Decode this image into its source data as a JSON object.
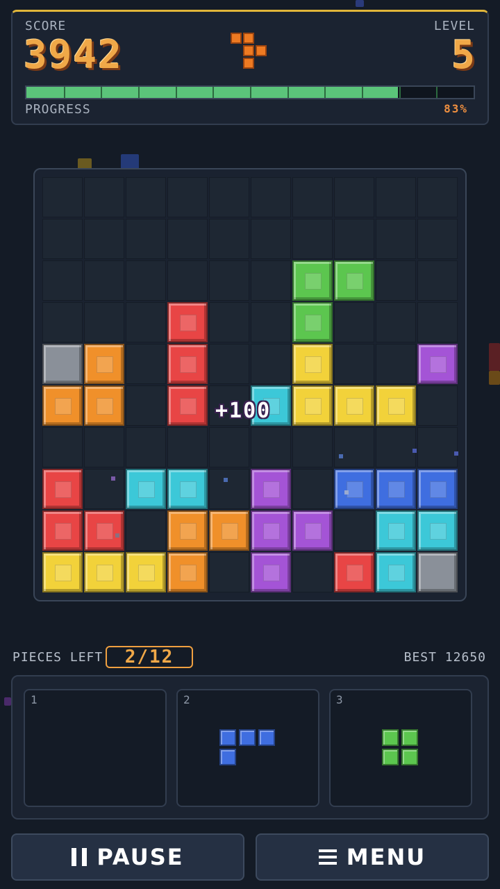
{
  "hud": {
    "score_label": "SCORE",
    "score_value": "3942",
    "level_label": "LEVEL",
    "level_value": "5",
    "progress_label": "PROGRESS",
    "progress_percent_text": "83%",
    "progress_fraction": 0.83
  },
  "board": {
    "rows": 10,
    "cols": 10,
    "blocks": [
      {
        "row": 2,
        "col": 6,
        "color": "green"
      },
      {
        "row": 2,
        "col": 7,
        "color": "green"
      },
      {
        "row": 3,
        "col": 3,
        "color": "red"
      },
      {
        "row": 3,
        "col": 6,
        "color": "green"
      },
      {
        "row": 4,
        "col": 0,
        "color": "gray"
      },
      {
        "row": 4,
        "col": 1,
        "color": "orange"
      },
      {
        "row": 4,
        "col": 3,
        "color": "red"
      },
      {
        "row": 4,
        "col": 6,
        "color": "yellow"
      },
      {
        "row": 4,
        "col": 9,
        "color": "purple"
      },
      {
        "row": 5,
        "col": 0,
        "color": "orange"
      },
      {
        "row": 5,
        "col": 1,
        "color": "orange"
      },
      {
        "row": 5,
        "col": 3,
        "color": "red"
      },
      {
        "row": 5,
        "col": 5,
        "color": "cyan"
      },
      {
        "row": 5,
        "col": 6,
        "color": "yellow"
      },
      {
        "row": 5,
        "col": 7,
        "color": "yellow"
      },
      {
        "row": 5,
        "col": 8,
        "color": "yellow"
      },
      {
        "row": 7,
        "col": 0,
        "color": "red"
      },
      {
        "row": 7,
        "col": 2,
        "color": "cyan"
      },
      {
        "row": 7,
        "col": 3,
        "color": "cyan"
      },
      {
        "row": 7,
        "col": 5,
        "color": "purple"
      },
      {
        "row": 7,
        "col": 7,
        "color": "blue"
      },
      {
        "row": 7,
        "col": 8,
        "color": "blue"
      },
      {
        "row": 7,
        "col": 9,
        "color": "blue"
      },
      {
        "row": 8,
        "col": 0,
        "color": "red"
      },
      {
        "row": 8,
        "col": 1,
        "color": "red"
      },
      {
        "row": 8,
        "col": 3,
        "color": "orange"
      },
      {
        "row": 8,
        "col": 4,
        "color": "orange"
      },
      {
        "row": 8,
        "col": 5,
        "color": "purple"
      },
      {
        "row": 8,
        "col": 6,
        "color": "purple"
      },
      {
        "row": 8,
        "col": 8,
        "color": "cyan"
      },
      {
        "row": 8,
        "col": 9,
        "color": "cyan"
      },
      {
        "row": 9,
        "col": 0,
        "color": "yellow"
      },
      {
        "row": 9,
        "col": 1,
        "color": "yellow"
      },
      {
        "row": 9,
        "col": 2,
        "color": "yellow"
      },
      {
        "row": 9,
        "col": 3,
        "color": "orange"
      },
      {
        "row": 9,
        "col": 5,
        "color": "purple"
      },
      {
        "row": 9,
        "col": 7,
        "color": "red"
      },
      {
        "row": 9,
        "col": 8,
        "color": "cyan"
      },
      {
        "row": 9,
        "col": 9,
        "color": "gray"
      }
    ],
    "score_popup": "+100"
  },
  "pieces": {
    "label": "PIECES LEFT",
    "count": "2/12",
    "best_label": "BEST 12650",
    "slots": [
      {
        "number": "1",
        "piece": "empty"
      },
      {
        "number": "2",
        "piece": "blue-L"
      },
      {
        "number": "3",
        "piece": "green-square"
      }
    ]
  },
  "buttons": {
    "pause_label": "PAUSE",
    "menu_label": "MENU"
  },
  "colors": {
    "red": "#e84545",
    "orange": "#f0902a",
    "yellow": "#f2d23a",
    "green": "#5cc64f",
    "cyan": "#3cc8d8",
    "blue": "#3f6ee0",
    "purple": "#a454d6",
    "gray": "#8a9099",
    "accent": "#f0a848",
    "progress": "#5bc47a"
  },
  "icons": [
    "logo-tetromino-icon",
    "pause-icon",
    "menu-icon"
  ]
}
